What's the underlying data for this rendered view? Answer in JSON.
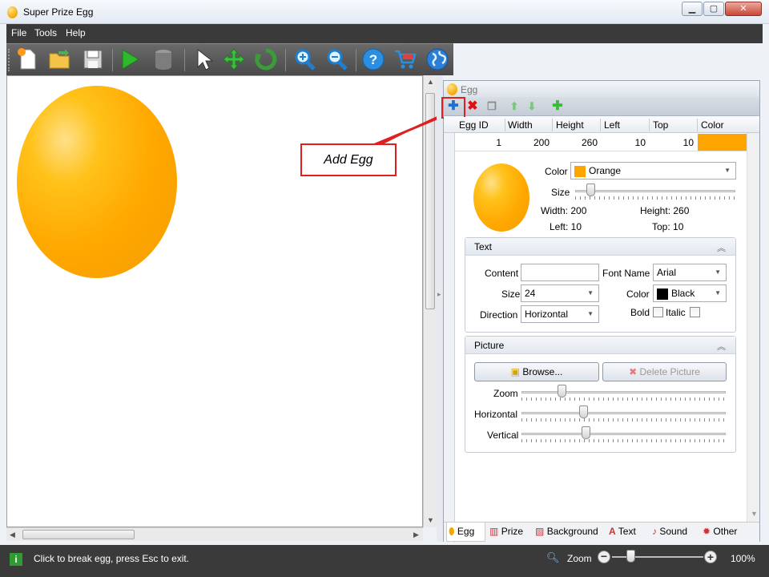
{
  "window": {
    "title": "Super Prize Egg",
    "min": "▁",
    "max": "▢",
    "close": "✕"
  },
  "menu": [
    "File",
    "Tools",
    "Help"
  ],
  "toolbar": {
    "icons": [
      "new-file-icon",
      "open-folder-icon",
      "save-icon",
      "play-icon",
      "database-icon",
      "pointer-icon",
      "move-icon",
      "rotate-icon",
      "zoom-in-icon",
      "zoom-out-icon",
      "help-icon",
      "cart-icon",
      "globe-icon"
    ]
  },
  "callout": {
    "text": "Add Egg"
  },
  "panel": {
    "title": "Egg",
    "grid": {
      "headers": [
        "Egg ID",
        "Width",
        "Height",
        "Left",
        "Top",
        "Color"
      ],
      "row": [
        "1",
        "200",
        "260",
        "10",
        "10"
      ],
      "row_color": "#ffa500"
    },
    "egg": {
      "color_label": "Color",
      "color_value": "Orange",
      "color_swatch": "#ffa500",
      "size_label": "Size",
      "width": "Width: 200",
      "height": "Height: 260",
      "left": "Left: 10",
      "top": "Top: 10"
    },
    "text_group": {
      "title": "Text",
      "content_label": "Content",
      "content_value": "",
      "fontname_label": "Font Name",
      "fontname_value": "Arial",
      "size_label": "Size",
      "size_value": "24",
      "color_label": "Color",
      "color_value": "Black",
      "color_swatch": "#000000",
      "direction_label": "Direction",
      "direction_value": "Horizontal",
      "bold_label": "Bold",
      "italic_label": "Italic"
    },
    "picture_group": {
      "title": "Picture",
      "browse_label": "Browse...",
      "delete_label": "Delete Picture",
      "zoom_label": "Zoom",
      "horizontal_label": "Horizontal",
      "vertical_label": "Vertical"
    },
    "tabs": [
      "Egg",
      "Prize",
      "Background",
      "Text",
      "Sound",
      "Other"
    ]
  },
  "status": {
    "text": "Click to break egg, press Esc to exit.",
    "zoom_label": "Zoom",
    "zoom_value": "100%"
  }
}
